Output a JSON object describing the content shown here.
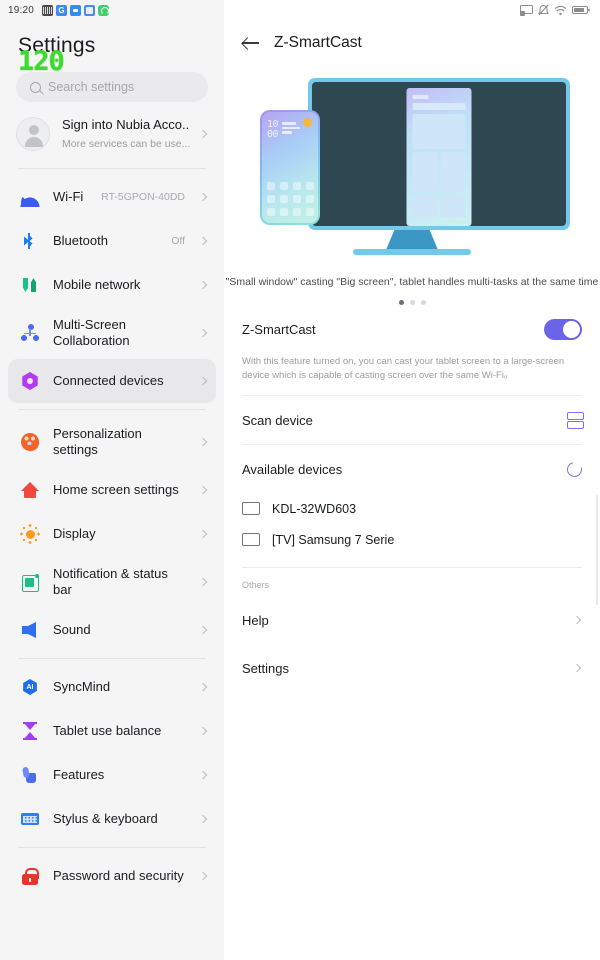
{
  "status_bar": {
    "time": "19:20",
    "left_icons": [
      "screenshot-icon",
      "gmail-icon",
      "message-icon",
      "app-icon",
      "whatsapp-icon"
    ],
    "right_icons": [
      "cast-icon",
      "mute-icon",
      "wifi-icon",
      "battery-icon"
    ]
  },
  "fps_overlay": {
    "value": "120",
    "color": "#3ddb2e"
  },
  "sidebar": {
    "title": "Settings",
    "search": {
      "placeholder": "Search settings",
      "icon": "search-icon"
    },
    "account": {
      "title": "Sign into Nubia Acco..",
      "subtitle": "More services can be use...",
      "avatar": "user-avatar"
    },
    "groups": [
      {
        "items": [
          {
            "label": "Wi-Fi",
            "value": "RT-5GPON-40DD",
            "icon": "wifi-icon",
            "selected": false
          },
          {
            "label": "Bluetooth",
            "value": "Off",
            "icon": "bluetooth-icon",
            "selected": false
          },
          {
            "label": "Mobile network",
            "value": "",
            "icon": "mobile-network-icon",
            "selected": false
          },
          {
            "label": "Multi-Screen Collaboration",
            "value": "",
            "icon": "multi-screen-icon",
            "selected": false
          },
          {
            "label": "Connected devices",
            "value": "",
            "icon": "connected-devices-icon",
            "selected": true
          }
        ]
      },
      {
        "items": [
          {
            "label": "Personalization settings",
            "value": "",
            "icon": "palette-icon",
            "selected": false
          },
          {
            "label": "Home screen settings",
            "value": "",
            "icon": "home-icon",
            "selected": false
          },
          {
            "label": "Display",
            "value": "",
            "icon": "brightness-icon",
            "selected": false
          },
          {
            "label": "Notification & status bar",
            "value": "",
            "icon": "notification-icon",
            "selected": false
          },
          {
            "label": "Sound",
            "value": "",
            "icon": "speaker-icon",
            "selected": false
          }
        ]
      },
      {
        "items": [
          {
            "label": "SyncMind",
            "value": "",
            "icon": "syncmind-ai-icon",
            "selected": false
          },
          {
            "label": "Tablet use balance",
            "value": "",
            "icon": "hourglass-icon",
            "selected": false
          },
          {
            "label": "Features",
            "value": "",
            "icon": "gesture-icon",
            "selected": false
          },
          {
            "label": "Stylus & keyboard",
            "value": "",
            "icon": "keyboard-icon",
            "selected": false
          }
        ]
      },
      {
        "items": [
          {
            "label": "Password and security",
            "value": "",
            "icon": "lock-icon",
            "selected": false
          }
        ]
      }
    ]
  },
  "main": {
    "back_icon": "back-arrow-icon",
    "title": "Z-SmartCast",
    "illustration": {
      "phone_clock": "10\n00",
      "caption": "\"Small window\" casting \"Big screen\", tablet handles multi-tasks at the same time",
      "dots": {
        "count": 3,
        "active_index": 0
      }
    },
    "feature": {
      "label": "Z-SmartCast",
      "toggle_on": true,
      "toggle_color": "#6b63e8",
      "description": "With this feature turned on, you can cast your tablet screen to a large-screen device which is capable of casting screen over the same Wi-Fi。"
    },
    "scan": {
      "label": "Scan device",
      "icon": "split-screen-icon"
    },
    "available": {
      "label": "Available devices",
      "icon": "refresh-icon",
      "devices": [
        {
          "name": "KDL-32WD603",
          "icon": "tv-icon"
        },
        {
          "name": "[TV] Samsung 7 Serie",
          "icon": "tv-icon"
        }
      ]
    },
    "others": {
      "label": "Others",
      "items": [
        {
          "label": "Help"
        },
        {
          "label": "Settings"
        }
      ]
    }
  }
}
